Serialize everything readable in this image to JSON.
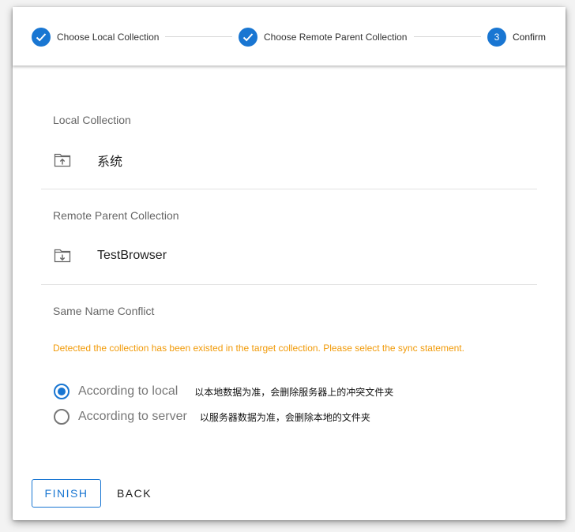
{
  "stepper": {
    "steps": [
      {
        "label": "Choose Local Collection",
        "state": "done",
        "icon": "check-icon"
      },
      {
        "label": "Choose Remote Parent Collection",
        "state": "done",
        "icon": "check-icon"
      },
      {
        "label": "Confirm",
        "state": "active",
        "number": "3"
      }
    ]
  },
  "local": {
    "title": "Local Collection",
    "name": "系统",
    "icon": "folder-upload-icon"
  },
  "remote": {
    "title": "Remote Parent Collection",
    "name": "TestBrowser",
    "icon": "folder-download-icon"
  },
  "conflict": {
    "title": "Same Name Conflict",
    "warning": "Detected the collection has been existed in the target collection. Please select the sync statement.",
    "options": [
      {
        "label": "According to local",
        "desc": "以本地数据为准，会删除服务器上的冲突文件夹",
        "checked": true
      },
      {
        "label": "According to server",
        "desc": "以服务器数据为准，会删除本地的文件夹",
        "checked": false
      }
    ]
  },
  "actions": {
    "finish_label": "FINISH",
    "back_label": "BACK"
  },
  "colors": {
    "primary": "#1976d2",
    "warning": "#f19a08"
  }
}
